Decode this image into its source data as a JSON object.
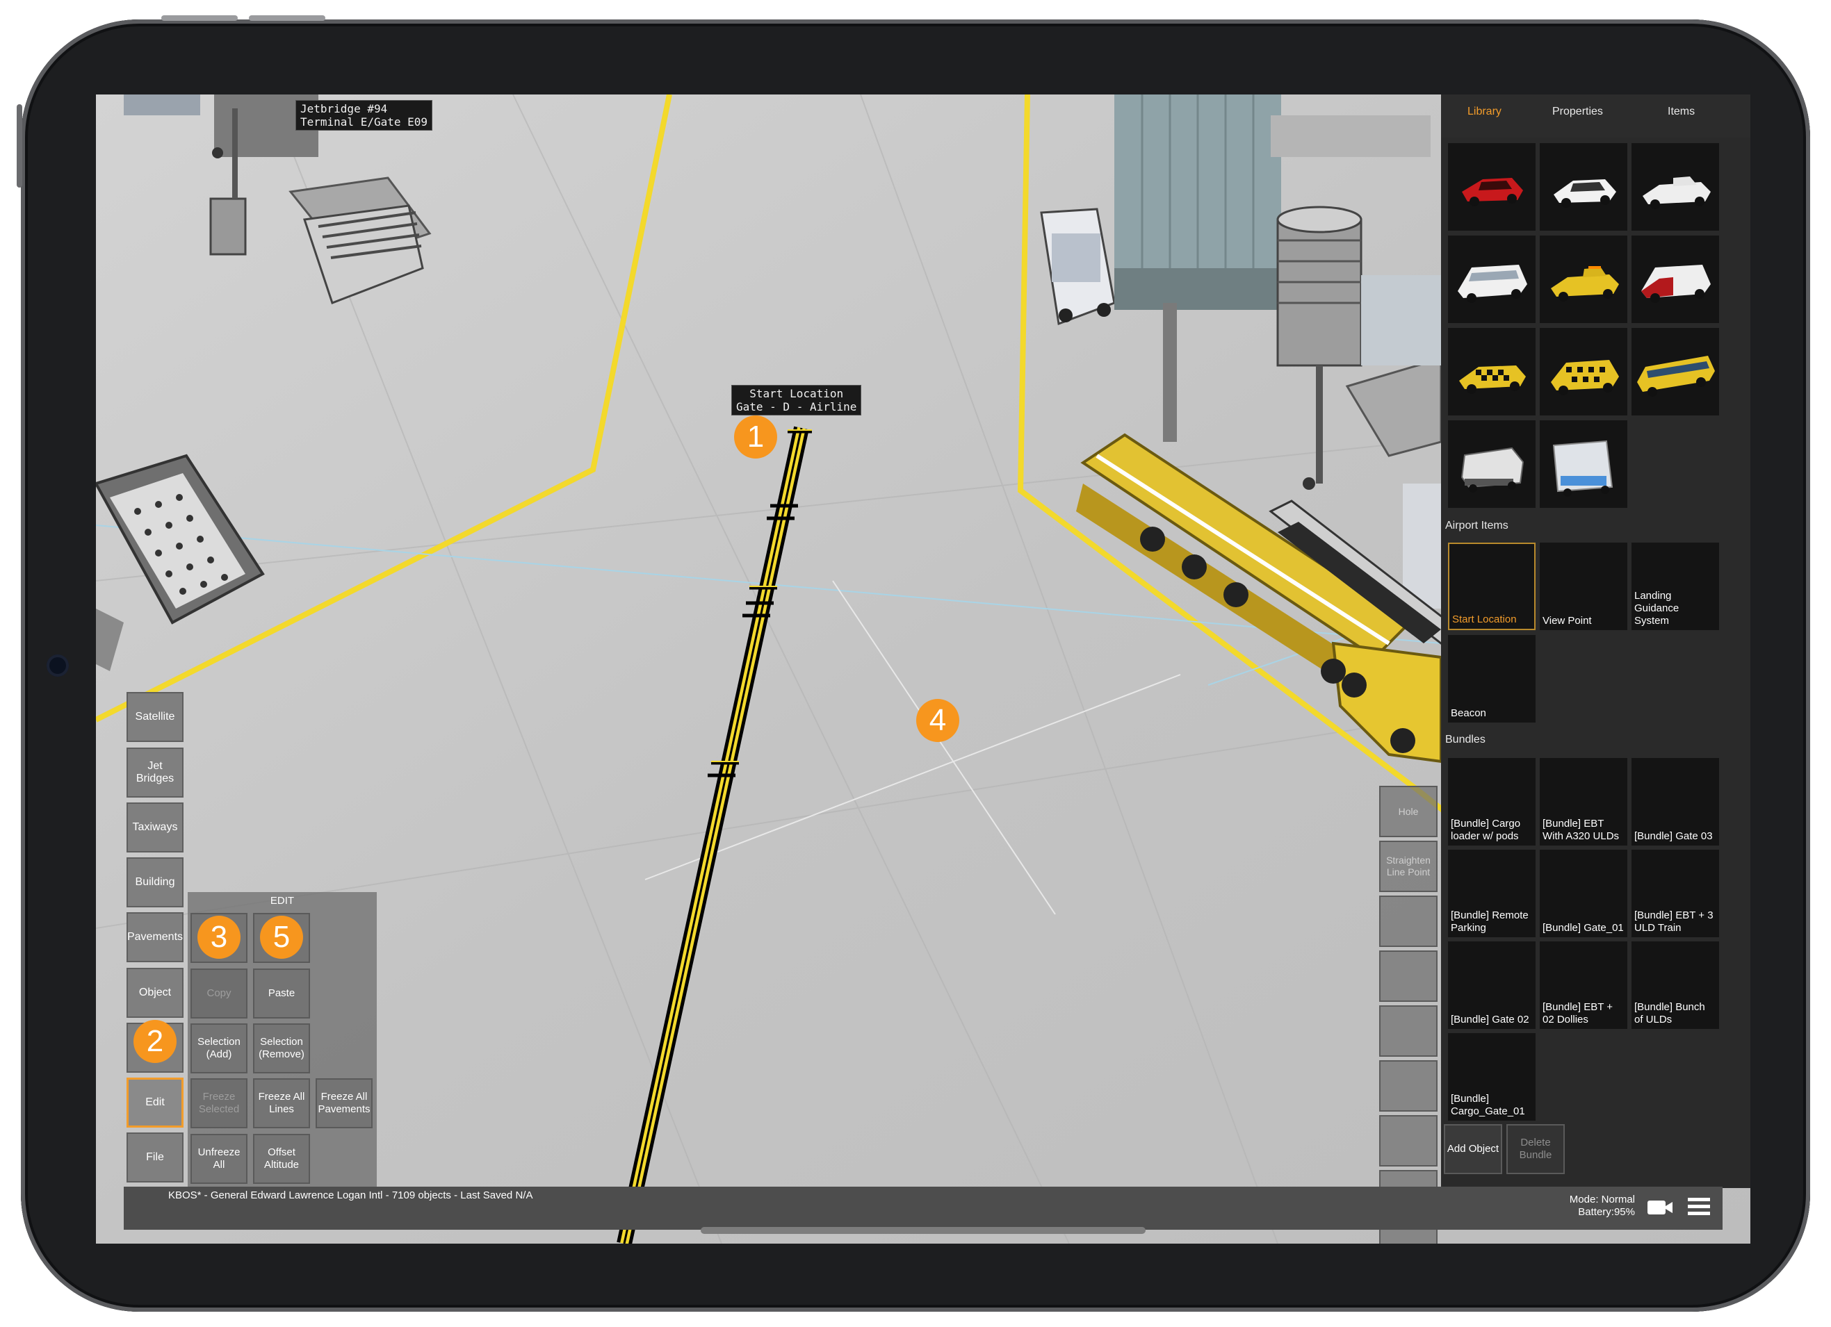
{
  "map": {
    "jetbridge_label_line1": "Jetbridge #94",
    "jetbridge_label_line2": "Terminal E/Gate E09",
    "start_location_line1": "Start Location",
    "start_location_line2": "Gate - D - Airline"
  },
  "markers": {
    "m1": "1",
    "m2": "2",
    "m3": "3",
    "m4": "4",
    "m5": "5"
  },
  "left_menu": {
    "satellite": "Satellite",
    "jet_bridges": "Jet Bridges",
    "taxiways": "Taxiways",
    "building": "Building",
    "pavements": "Pavements",
    "object": "Object",
    "edit": "Edit",
    "file": "File"
  },
  "edit_panel": {
    "title": "EDIT",
    "copy": "Copy",
    "paste": "Paste",
    "selection_add": "Selection (Add)",
    "selection_remove": "Selection (Remove)",
    "freeze_selected": "Freeze Selected",
    "freeze_all_lines": "Freeze All Lines",
    "freeze_all_pavements": "Freeze All Pavements",
    "unfreeze_all": "Unfreeze All",
    "offset_altitude": "Offset Altitude"
  },
  "right_tools": {
    "hole": "Hole",
    "straighten": "Straighten Line Point"
  },
  "side_panel": {
    "tabs": {
      "library": "Library",
      "properties": "Properties",
      "items": "Items"
    },
    "airport_items_header": "Airport Items",
    "airport_items": [
      "Start Location",
      "View Point",
      "Landing Guidance System",
      "Beacon"
    ],
    "bundles_header": "Bundles",
    "bundles": [
      "[Bundle] Cargo loader w/ pods",
      "[Bundle] EBT With A320 ULDs",
      "[Bundle] Gate 03",
      "[Bundle] Remote Parking",
      "[Bundle] Gate_01",
      "[Bundle] EBT + 3 ULD Train",
      "[Bundle] Gate 02",
      "[Bundle] EBT + 02 Dollies",
      "[Bundle] Bunch of ULDs",
      "[Bundle] Cargo_Gate_01"
    ],
    "add_object": "Add Object",
    "delete_bundle": "Delete Bundle",
    "vehicle_icons": [
      "red-car-icon",
      "white-sedan-icon",
      "white-pickup-icon",
      "white-van-icon",
      "yellow-pickup-icon",
      "red-van-icon",
      "checkered-car-icon",
      "checkered-suv-icon",
      "yellow-bus-icon",
      "catering-truck-icon",
      "service-truck-icon"
    ]
  },
  "status": {
    "airport": "KBOS* - General Edward Lawrence Logan Intl - 7109 objects - Last Saved N/A",
    "mode": "Mode: Normal",
    "battery": "Battery:95%"
  }
}
